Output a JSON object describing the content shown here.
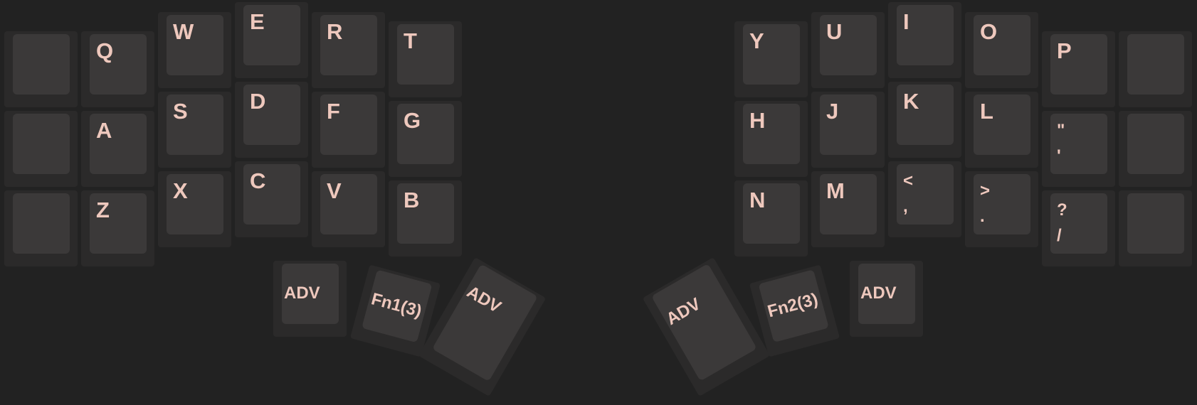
{
  "keyboard": {
    "left": {
      "row1": [
        "",
        "Q",
        "W",
        "E",
        "R",
        "T"
      ],
      "row2": [
        "",
        "A",
        "S",
        "D",
        "F",
        "G"
      ],
      "row3": [
        "",
        "Z",
        "X",
        "C",
        "V",
        "B"
      ],
      "thumbs": [
        "ADV",
        "Fn1(3)",
        "ADV"
      ]
    },
    "right": {
      "row1": [
        "Y",
        "U",
        "I",
        "O",
        "P",
        ""
      ],
      "row2": [
        "H",
        "J",
        "K",
        "L",
        "",
        ""
      ],
      "row3": [
        "N",
        "M",
        "",
        "",
        "",
        ""
      ],
      "row2_quote": {
        "shifted": "\"",
        "base": "'"
      },
      "row3_comma": {
        "shifted": "<",
        "base": ","
      },
      "row3_period": {
        "shifted": ">",
        "base": "."
      },
      "row3_slash": {
        "shifted": "?",
        "base": "/"
      },
      "thumbs": [
        "ADV",
        "Fn2(3)",
        "ADV"
      ]
    }
  }
}
